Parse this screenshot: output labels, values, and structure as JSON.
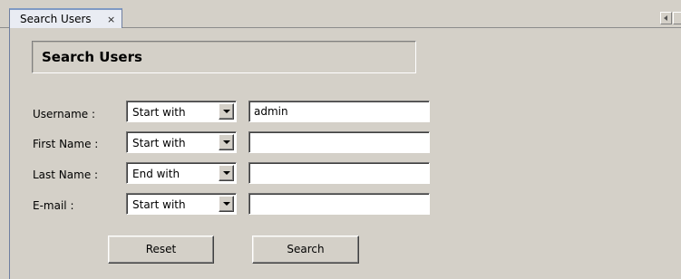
{
  "tabs": [
    {
      "label": "Search Users",
      "close": "×"
    }
  ],
  "page": {
    "title": "Search Users"
  },
  "form": {
    "fields": [
      {
        "label": "Username :",
        "operator": "Start with",
        "value": "admin"
      },
      {
        "label": "First Name :",
        "operator": "Start with",
        "value": ""
      },
      {
        "label": "Last Name :",
        "operator": "End with",
        "value": ""
      },
      {
        "label": "E-mail :",
        "operator": "Start with",
        "value": ""
      }
    ]
  },
  "buttons": {
    "reset": "Reset",
    "search": "Search"
  }
}
